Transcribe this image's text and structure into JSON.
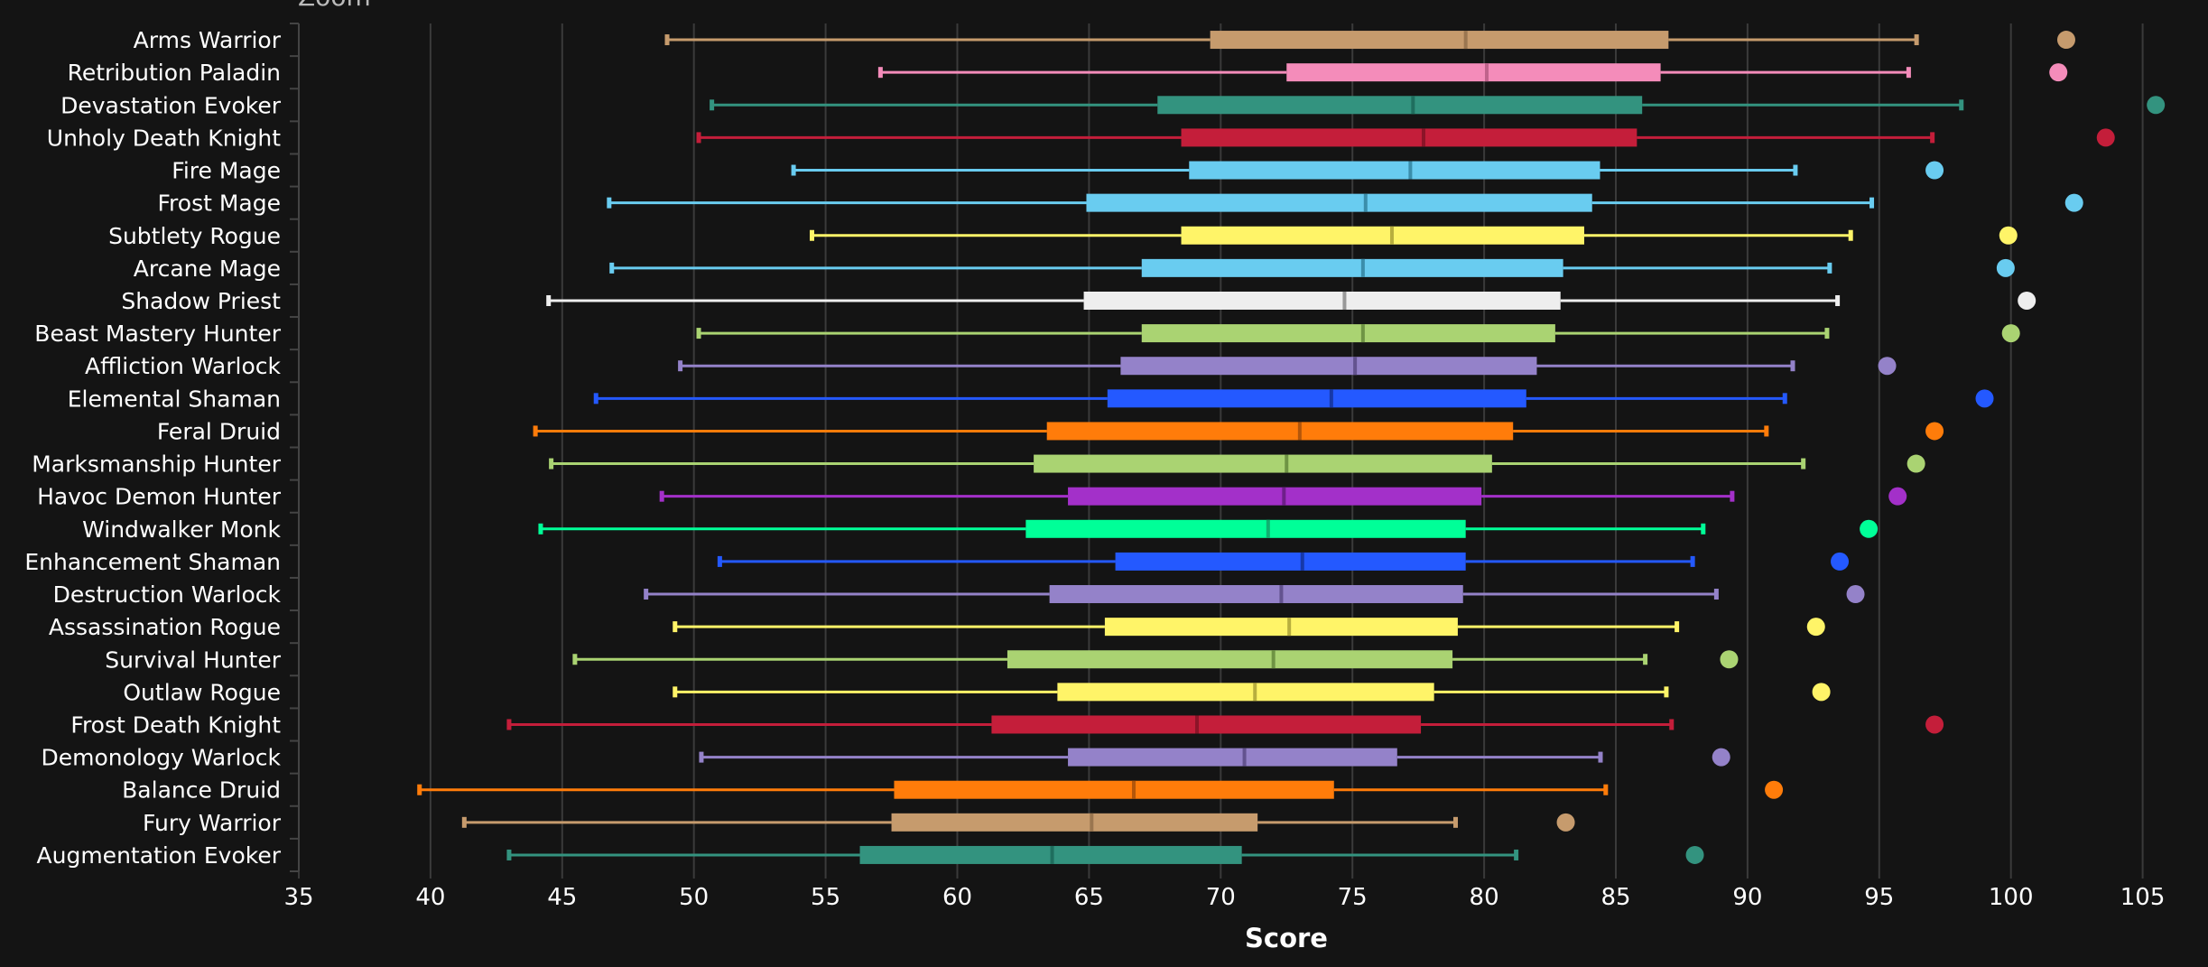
{
  "chart_data": {
    "type": "boxplot",
    "title": "Zoom",
    "xlabel": "Score",
    "ylabel": "",
    "xlim": [
      35,
      107
    ],
    "xticks": [
      35,
      40,
      45,
      50,
      55,
      60,
      65,
      70,
      75,
      80,
      85,
      90,
      95,
      100,
      105
    ],
    "grid": true,
    "legend": "none",
    "background": "#141414",
    "gridline_color": "#3a3a3a",
    "series": [
      {
        "name": "Arms Warrior",
        "color": "#C69B6D",
        "median_color": "#9a7650",
        "min": 49.0,
        "q1": 69.6,
        "median": 79.3,
        "q3": 87.0,
        "max": 96.4,
        "outlier": 102.1
      },
      {
        "name": "Retribution Paladin",
        "color": "#F48CBA",
        "median_color": "#c0638c",
        "min": 57.1,
        "q1": 72.5,
        "median": 80.1,
        "q3": 86.7,
        "max": 96.1,
        "outlier": 101.8
      },
      {
        "name": "Devastation Evoker",
        "color": "#33937F",
        "median_color": "#1f6e5e",
        "min": 50.7,
        "q1": 67.6,
        "median": 77.3,
        "q3": 86.0,
        "max": 98.1,
        "outlier": 105.5
      },
      {
        "name": "Unholy Death Knight",
        "color": "#C41E3A",
        "median_color": "#8c1428",
        "min": 50.2,
        "q1": 68.5,
        "median": 77.7,
        "q3": 85.8,
        "max": 97.0,
        "outlier": 103.6
      },
      {
        "name": "Fire Mage",
        "color": "#69CCF0",
        "median_color": "#3b8eab",
        "min": 53.8,
        "q1": 68.8,
        "median": 77.2,
        "q3": 84.4,
        "max": 91.8,
        "outlier": 97.1
      },
      {
        "name": "Frost Mage",
        "color": "#69CCF0",
        "median_color": "#3b8eab",
        "min": 46.8,
        "q1": 64.9,
        "median": 75.5,
        "q3": 84.1,
        "max": 94.7,
        "outlier": 102.4
      },
      {
        "name": "Subtlety Rogue",
        "color": "#FFF468",
        "median_color": "#b8ae3e",
        "min": 54.5,
        "q1": 68.5,
        "median": 76.5,
        "q3": 83.8,
        "max": 93.9,
        "outlier": 99.9
      },
      {
        "name": "Arcane Mage",
        "color": "#69CCF0",
        "median_color": "#3b8eab",
        "min": 46.9,
        "q1": 67.0,
        "median": 75.4,
        "q3": 83.0,
        "max": 93.1,
        "outlier": 99.8
      },
      {
        "name": "Shadow Priest",
        "color": "#EEEEEE",
        "median_color": "#999999",
        "min": 44.5,
        "q1": 64.8,
        "median": 74.7,
        "q3": 82.9,
        "max": 93.4,
        "outlier": 100.6
      },
      {
        "name": "Beast Mastery Hunter",
        "color": "#AAD372",
        "median_color": "#6f9444",
        "min": 50.2,
        "q1": 67.0,
        "median": 75.4,
        "q3": 82.7,
        "max": 93.0,
        "outlier": 100.0
      },
      {
        "name": "Affliction Warlock",
        "color": "#9482C9",
        "median_color": "#63538f",
        "min": 49.5,
        "q1": 66.2,
        "median": 75.1,
        "q3": 82.0,
        "max": 91.7,
        "outlier": 95.3
      },
      {
        "name": "Elemental Shaman",
        "color": "#2459FF",
        "median_color": "#1638a8",
        "min": 46.3,
        "q1": 65.7,
        "median": 74.2,
        "q3": 81.6,
        "max": 91.4,
        "outlier": 99.0
      },
      {
        "name": "Feral Druid",
        "color": "#FF7C0A",
        "median_color": "#b3560a",
        "min": 44.0,
        "q1": 63.4,
        "median": 73.0,
        "q3": 81.1,
        "max": 90.7,
        "outlier": 97.1
      },
      {
        "name": "Marksmanship Hunter",
        "color": "#AAD372",
        "median_color": "#6f9444",
        "min": 44.6,
        "q1": 62.9,
        "median": 72.5,
        "q3": 80.3,
        "max": 92.1,
        "outlier": 96.4
      },
      {
        "name": "Havoc Demon Hunter",
        "color": "#A330C9",
        "median_color": "#6e1f8a",
        "min": 48.8,
        "q1": 64.2,
        "median": 72.4,
        "q3": 79.9,
        "max": 89.4,
        "outlier": 95.7
      },
      {
        "name": "Windwalker Monk",
        "color": "#00FF98",
        "median_color": "#10b070",
        "min": 44.2,
        "q1": 62.6,
        "median": 71.8,
        "q3": 79.3,
        "max": 88.3,
        "outlier": 94.6
      },
      {
        "name": "Enhancement Shaman",
        "color": "#2459FF",
        "median_color": "#1638a8",
        "min": 51.0,
        "q1": 66.0,
        "median": 73.1,
        "q3": 79.3,
        "max": 87.9,
        "outlier": 93.5
      },
      {
        "name": "Destruction Warlock",
        "color": "#9482C9",
        "median_color": "#63538f",
        "min": 48.2,
        "q1": 63.5,
        "median": 72.3,
        "q3": 79.2,
        "max": 88.8,
        "outlier": 94.1
      },
      {
        "name": "Assassination Rogue",
        "color": "#FFF468",
        "median_color": "#b8ae3e",
        "min": 49.3,
        "q1": 65.6,
        "median": 72.6,
        "q3": 79.0,
        "max": 87.3,
        "outlier": 92.6
      },
      {
        "name": "Survival Hunter",
        "color": "#AAD372",
        "median_color": "#6f9444",
        "min": 45.5,
        "q1": 61.9,
        "median": 72.0,
        "q3": 78.8,
        "max": 86.1,
        "outlier": 89.3
      },
      {
        "name": "Outlaw Rogue",
        "color": "#FFF468",
        "median_color": "#b8ae3e",
        "min": 49.3,
        "q1": 63.8,
        "median": 71.3,
        "q3": 78.1,
        "max": 86.9,
        "outlier": 92.8
      },
      {
        "name": "Frost Death Knight",
        "color": "#C41E3A",
        "median_color": "#8c1428",
        "min": 43.0,
        "q1": 61.3,
        "median": 69.1,
        "q3": 77.6,
        "max": 87.1,
        "outlier": 97.1
      },
      {
        "name": "Demonology Warlock",
        "color": "#9482C9",
        "median_color": "#63538f",
        "min": 50.3,
        "q1": 64.2,
        "median": 70.9,
        "q3": 76.7,
        "max": 84.4,
        "outlier": 89.0
      },
      {
        "name": "Balance Druid",
        "color": "#FF7C0A",
        "median_color": "#b3560a",
        "min": 39.6,
        "q1": 57.6,
        "median": 66.7,
        "q3": 74.3,
        "max": 84.6,
        "outlier": 91.0
      },
      {
        "name": "Fury Warrior",
        "color": "#C69B6D",
        "median_color": "#9a7650",
        "min": 41.3,
        "q1": 57.5,
        "median": 65.1,
        "q3": 71.4,
        "max": 78.9,
        "outlier": 83.1
      },
      {
        "name": "Augmentation Evoker",
        "color": "#33937F",
        "median_color": "#1f6e5e",
        "min": 43.0,
        "q1": 56.3,
        "median": 63.6,
        "q3": 70.8,
        "max": 81.2,
        "outlier": 88.0
      }
    ]
  }
}
